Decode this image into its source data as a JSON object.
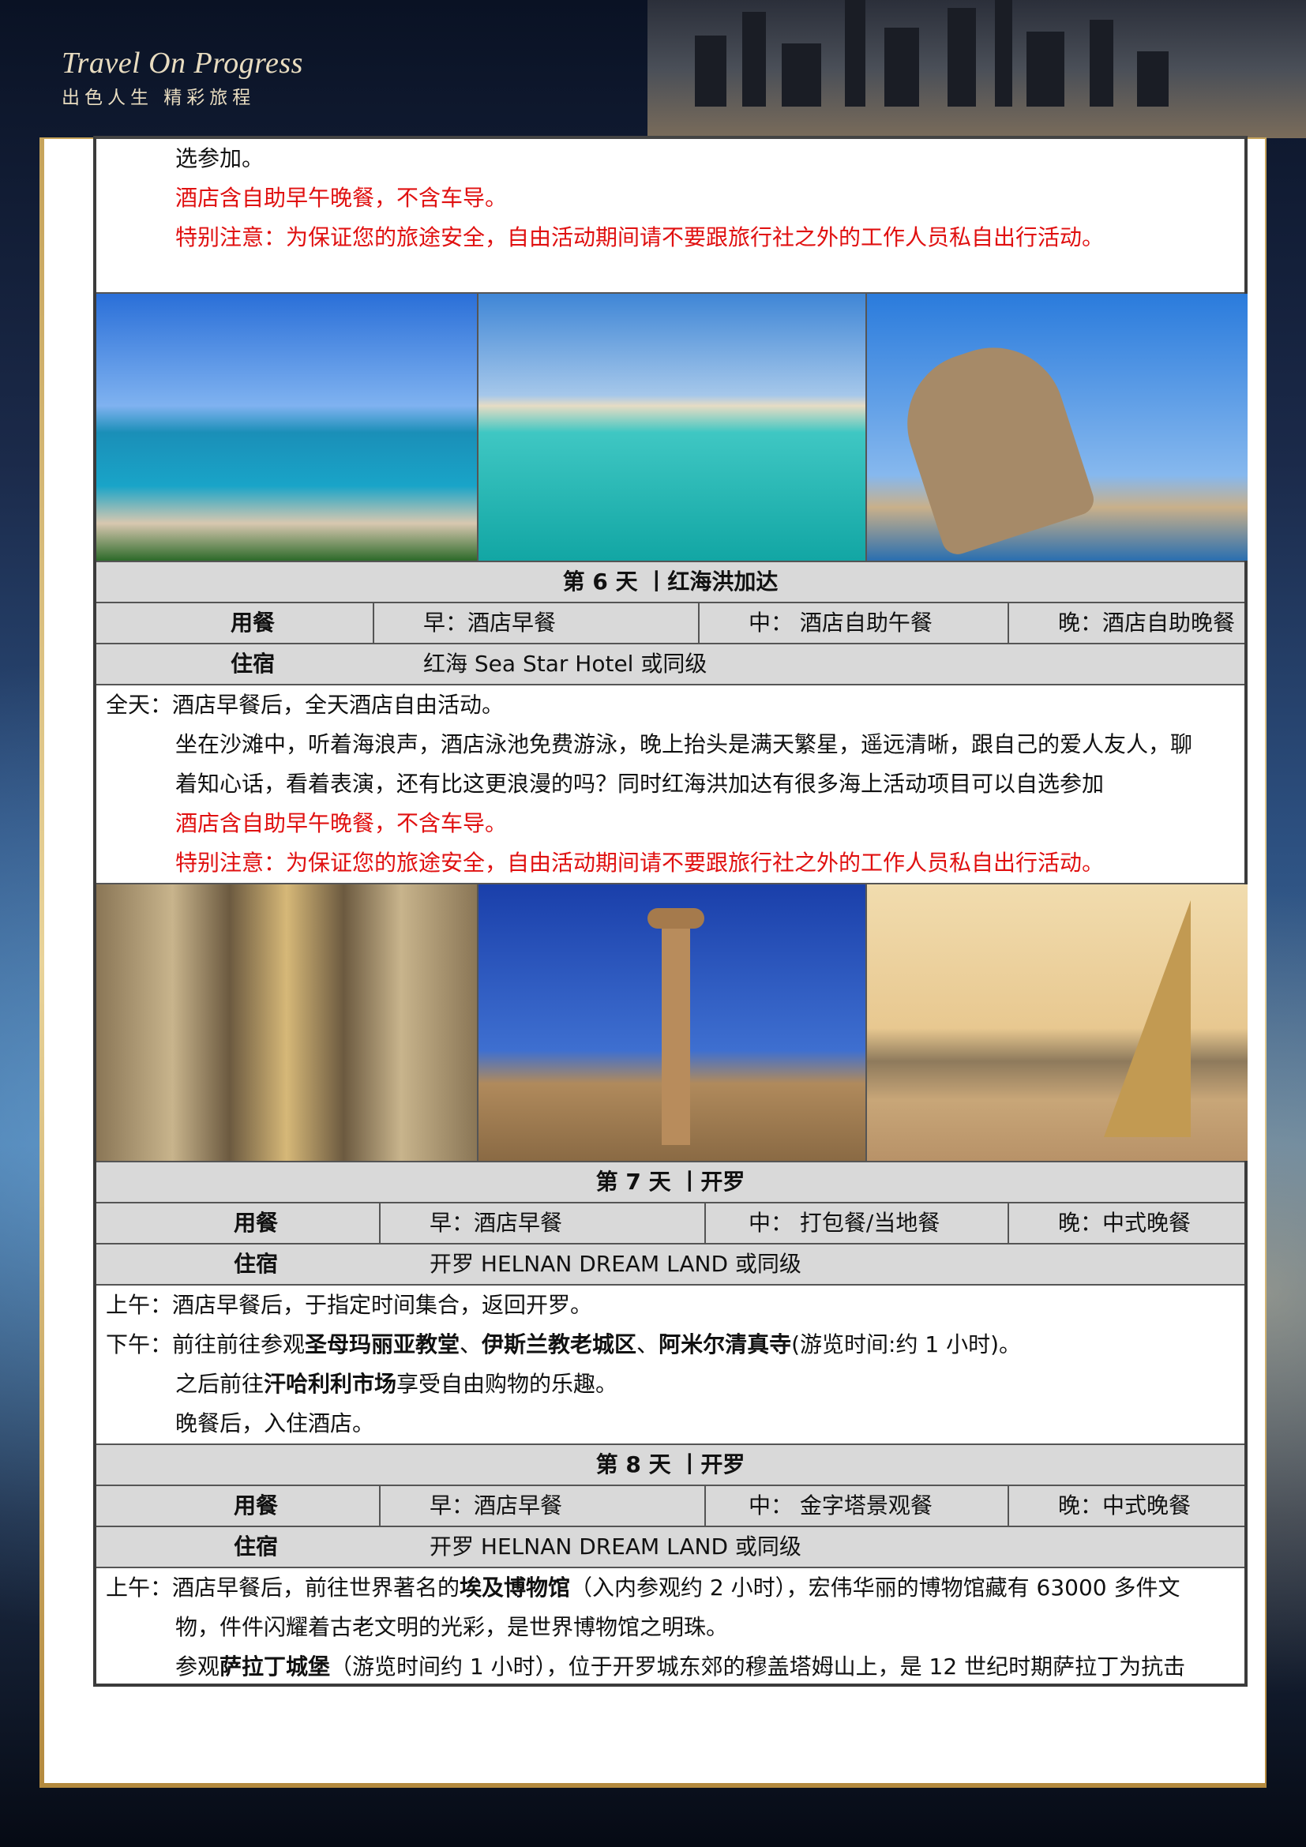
{
  "brand": {
    "name": "Travel On Progress",
    "slogan": "出色人生  精彩旅程"
  },
  "intro": {
    "line1": "选参加。",
    "line2": "酒店含自助早午晚餐，不含车导。",
    "line3": "特别注意：为保证您的旅途安全，自由活动期间请不要跟旅行社之外的工作人员私自出行活动。"
  },
  "day6": {
    "title": "第 6 天 丨红海洪加达",
    "meals_label": "用餐",
    "breakfast": "早：酒店早餐",
    "lunch": "中：  酒店自助午餐",
    "dinner": "晚：酒店自助晚餐",
    "hotel_label": "住宿",
    "hotel": "红海 Sea Star Hotel 或同级",
    "lines": [
      "全天：酒店早餐后，全天酒店自由活动。",
      "坐在沙滩中，听着海浪声，酒店泳池免费游泳，晚上抬头是满天繁星，遥远清晰，跟自己的爱人友人，聊",
      "着知心话，看着表演，还有比这更浪漫的吗？同时红海洪加达有很多海上活动项目可以自选参加",
      "酒店含自助早午晚餐，不含车导。",
      "特别注意：为保证您的旅途安全，自由活动期间请不要跟旅行社之外的工作人员私自出行活动。"
    ]
  },
  "day7": {
    "title": "第 7 天 丨开罗",
    "meals_label": "用餐",
    "breakfast": "早：酒店早餐",
    "lunch": "中：  打包餐/当地餐",
    "dinner": "晚：中式晚餐",
    "hotel_label": "住宿",
    "hotel": "开罗 HELNAN DREAM LAND 或同级",
    "line1": "上午：酒店早餐后，于指定时间集合，返回开罗。",
    "line2_pre": "下午：前往前往参观",
    "line2_b1": "圣母玛丽亚教堂",
    "line2_s1": "、",
    "line2_b2": "伊斯兰教老城区",
    "line2_s2": "、",
    "line2_b3": "阿米尔清真寺",
    "line2_post": "(游览时间:约 1 小时)。",
    "line3_pre": "之后前往",
    "line3_b": "汗哈利利市场",
    "line3_post": "享受自由购物的乐趣。",
    "line4": "晚餐后，入住酒店。"
  },
  "day8": {
    "title": "第 8 天 丨开罗",
    "meals_label": "用餐",
    "breakfast": "早：酒店早餐",
    "lunch": "中：  金字塔景观餐",
    "dinner": "晚：中式晚餐",
    "hotel_label": "住宿",
    "hotel": "开罗 HELNAN DREAM LAND 或同级",
    "line1_pre": "上午：酒店早餐后，前往世界著名的",
    "line1_b": "埃及博物馆",
    "line1_post": "（入内参观约 2 小时），宏伟华丽的博物馆藏有 63000 多件文",
    "line2": "物，件件闪耀着古老文明的光彩，是世界博物馆之明珠。",
    "line3_pre": "参观",
    "line3_b": "萨拉丁城堡",
    "line3_post": "（游览时间约 1 小时），位于开罗城东郊的穆盖塔姆山上，是 12 世纪时期萨拉丁为抗击"
  }
}
